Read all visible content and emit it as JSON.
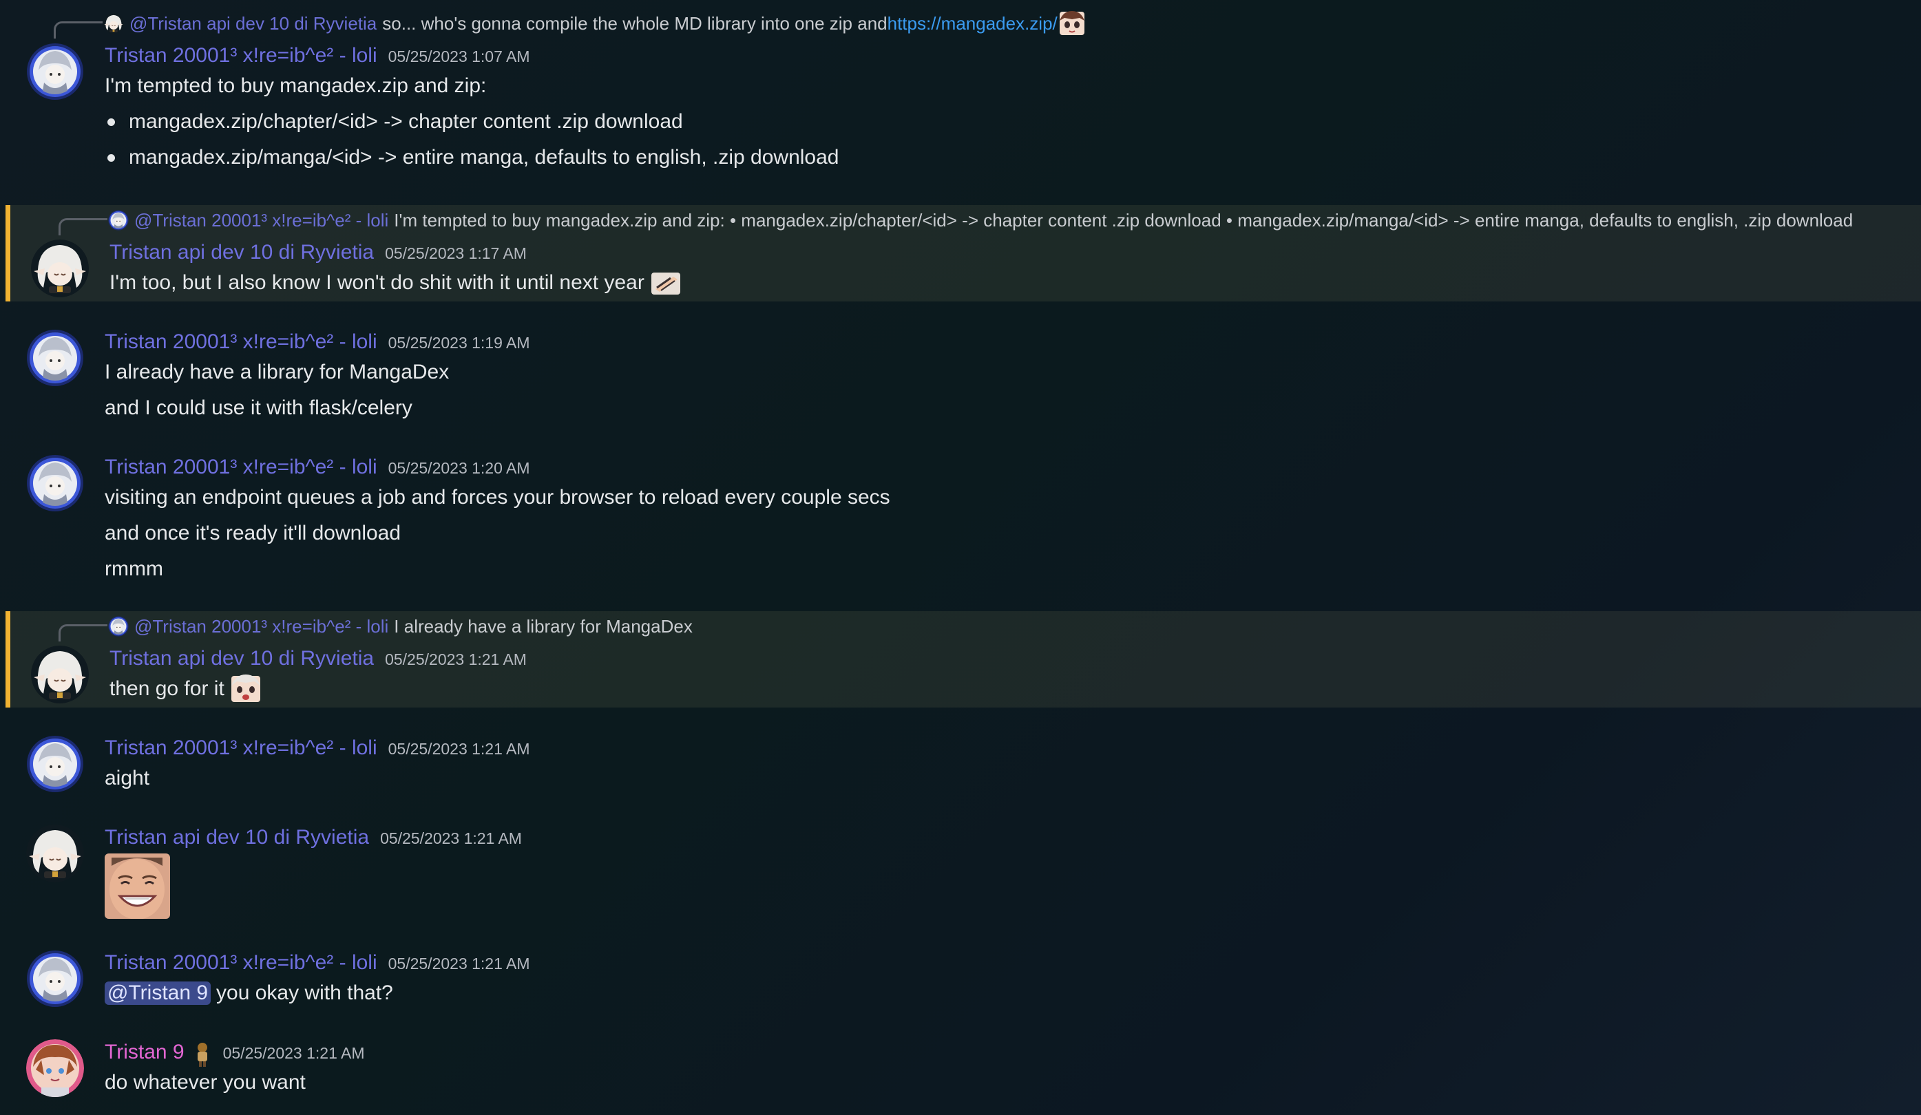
{
  "users": {
    "tristan2": "Tristan 20001³ x!re=ib^e² - loli",
    "ryvietia": "Tristan api dev 10 di Ryvietia",
    "tristan9": "Tristan 9"
  },
  "messages": [
    {
      "reply_to": "@Tristan api dev 10 di Ryvietia",
      "reply_text": "so... who's gonna compile the whole MD library into one zip and ",
      "reply_link": "https://mangadex.zip/",
      "author": "Tristan 20001³ x!re=ib^e² - loli",
      "timestamp": "05/25/2023 1:07 AM",
      "lines": [
        "I'm tempted to buy mangadex.zip and zip:",
        "mangadex.zip/chapter/<id> -> chapter content .zip download",
        "mangadex.zip/manga/<id> -> entire manga, defaults to english, .zip download"
      ]
    },
    {
      "reply_to": "@Tristan 20001³ x!re=ib^e² - loli",
      "reply_text": "I'm tempted to buy mangadex.zip and zip: • mangadex.zip/chapter/<id> -> chapter content .zip download  • mangadex.zip/manga/<id> -> entire manga, defaults to english, .zip download",
      "author": "Tristan api dev 10 di Ryvietia",
      "timestamp": "05/25/2023 1:17 AM",
      "lines": [
        "I'm too, but I also know I won't do shit with it until next year"
      ]
    },
    {
      "author": "Tristan 20001³ x!re=ib^e² - loli",
      "timestamp": "05/25/2023 1:19 AM",
      "lines": [
        "I already have a library for MangaDex",
        "and I could use it with flask/celery"
      ]
    },
    {
      "author": "Tristan 20001³ x!re=ib^e² - loli",
      "timestamp": "05/25/2023 1:20 AM",
      "lines": [
        "visiting an endpoint queues a job and forces your browser to reload every couple secs",
        "and once it's ready it'll download",
        "rmmm"
      ]
    },
    {
      "reply_to": "@Tristan 20001³ x!re=ib^e² - loli",
      "reply_text": "I already have a library for MangaDex",
      "author": "Tristan api dev 10 di Ryvietia",
      "timestamp": "05/25/2023 1:21 AM",
      "lines": [
        "then go for it"
      ]
    },
    {
      "author": "Tristan 20001³ x!re=ib^e² - loli",
      "timestamp": "05/25/2023 1:21 AM",
      "lines": [
        "aight"
      ]
    },
    {
      "author": "Tristan api dev 10 di Ryvietia",
      "timestamp": "05/25/2023 1:21 AM",
      "lines": []
    },
    {
      "author": "Tristan 20001³ x!re=ib^e² - loli",
      "timestamp": "05/25/2023 1:21 AM",
      "mention": "@Tristan 9",
      "lines": [
        "you okay with that?"
      ]
    },
    {
      "author": "Tristan 9",
      "timestamp": "05/25/2023 1:21 AM",
      "lines": [
        "do whatever you want"
      ]
    }
  ],
  "colors": {
    "username": "#6f70e0",
    "username_pink": "#e266d2",
    "link": "#3b9bf0",
    "highlight_bar": "#f0b232",
    "mention_bg": "#3b4a8c"
  },
  "icons": {
    "avatar_tristan2": "blue-ring-avatar-icon",
    "avatar_ryvietia": "white-haired-girl-avatar-icon",
    "avatar_tristan9": "pink-avatar-icon",
    "badge_tristan9": "character-badge-icon"
  }
}
